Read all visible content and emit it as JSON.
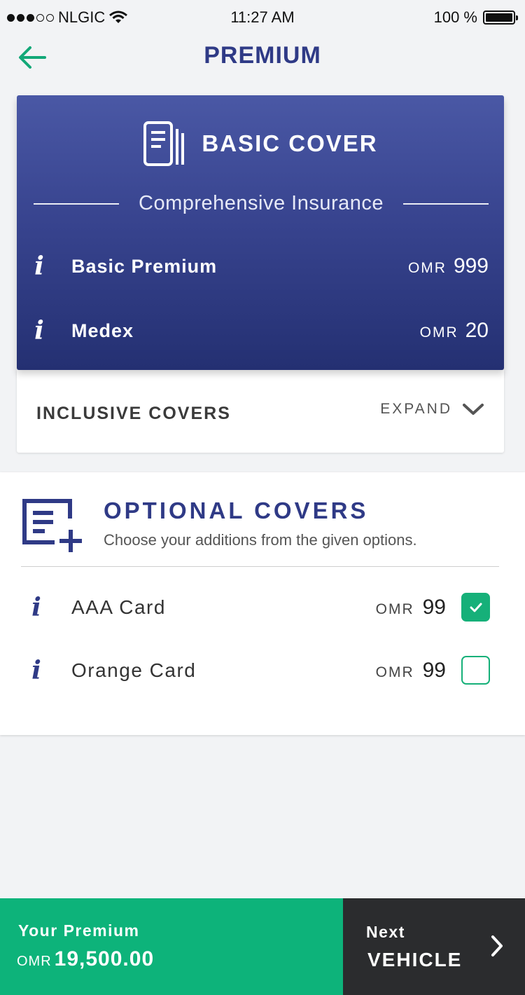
{
  "status_bar": {
    "carrier": "NLGIC",
    "time": "11:27 AM",
    "battery": "100 %"
  },
  "header": {
    "title": "PREMIUM",
    "back_icon": "arrow-left-icon"
  },
  "basic_cover": {
    "title": "BASIC COVER",
    "icon": "document-icon",
    "subtitle": "Comprehensive Insurance",
    "rows": [
      {
        "label": "Basic Premium",
        "currency": "OMR",
        "amount": "999"
      },
      {
        "label": "Medex",
        "currency": "OMR",
        "amount": "20"
      }
    ]
  },
  "inclusive": {
    "title": "INCLUSIVE COVERS",
    "expand_label": "EXPAND"
  },
  "optional": {
    "title": "OPTIONAL COVERS",
    "subtitle": "Choose your additions from the given options.",
    "items": [
      {
        "label": "AAA Card",
        "currency": "OMR",
        "amount": "99",
        "checked": true
      },
      {
        "label": "Orange Card",
        "currency": "OMR",
        "amount": "99",
        "checked": false
      }
    ]
  },
  "footer": {
    "premium_label": "Your Premium",
    "premium_currency": "OMR",
    "premium_amount": "19,500.00",
    "next_label": "Next",
    "next_sub": "VEHICLE"
  },
  "colors": {
    "brand_blue": "#2f3a86",
    "accent_green": "#0db37a",
    "dark": "#2b2c2e"
  }
}
